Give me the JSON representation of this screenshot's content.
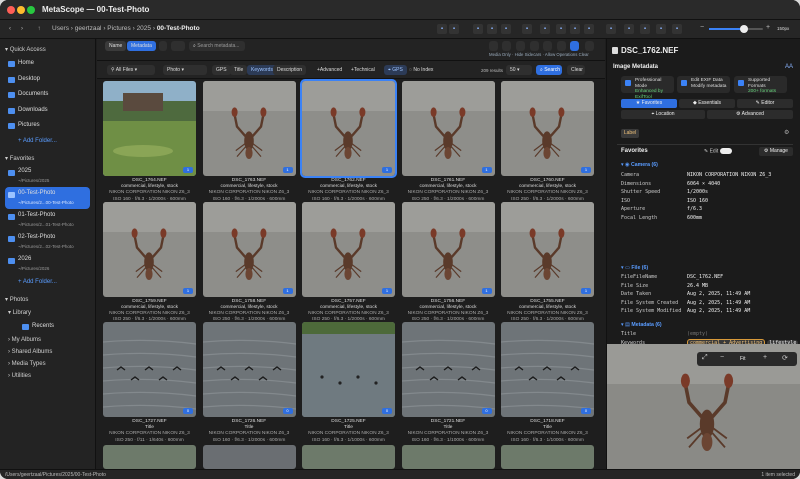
{
  "app": {
    "title": "MetaScope — 00-Test-Photo"
  },
  "breadcrumb": [
    "Users",
    "geertzaal",
    "Pictures",
    "2025",
    "00-Test-Photo"
  ],
  "toolbar": {
    "zoom": 0.65,
    "zoom_label": "150px"
  },
  "sidebar": {
    "quick_access_label": "Quick Access",
    "quick": [
      "Home",
      "Desktop",
      "Documents",
      "Downloads",
      "Pictures"
    ],
    "add_folder": "Add Folder...",
    "favorites_label": "Favorites",
    "favorites": [
      {
        "name": "2025",
        "path": "~/Pictures/2025"
      },
      {
        "name": "00-Test-Photo",
        "path": "~/Pictures/2...00-Test-Photo"
      },
      {
        "name": "01-Test-Photo",
        "path": "~/Pictures/2...01-Test-Photo"
      },
      {
        "name": "02-Test-Photo",
        "path": "~/Pictures/2...02-Test-Photo"
      },
      {
        "name": "2026",
        "path": "~/Pictures/2026"
      }
    ],
    "photos_label": "Photos",
    "library_label": "Library",
    "recents": "Recents",
    "groups": [
      "My Albums",
      "Shared Albums",
      "Media Types",
      "Utilities"
    ]
  },
  "filter": {
    "tabs": [
      "Name",
      "Metadata"
    ],
    "search_placeholder": "Search metadata...",
    "media_only": "Media Only",
    "hide_sidecars": "Hide Sidecars",
    "allow_operations": "Allow Operations",
    "clear": "Clear",
    "all_files": "All Files",
    "photo": "Photo",
    "field_chips": [
      "GPS",
      "Title",
      "Keywords",
      "Description"
    ],
    "advanced": "+Advanced",
    "technical": "+Technical",
    "gps": "GPS",
    "no_index": "No Index",
    "results": "209 results",
    "per_page": "50",
    "search_button": "Search",
    "clear_button": "Clear"
  },
  "photos": [
    {
      "name": "DSC_1764.NEF",
      "line1": "commercial, lifestyle, stock",
      "line2": "NIKON CORPORATION NIKON Z6_3",
      "line3": "ISO 160 · f/6.3 · 1/2000s · 600mm",
      "badge": "1",
      "kind": "field"
    },
    {
      "name": "DSC_1763.NEF",
      "line1": "commercial, lifestyle, stock",
      "line2": "NIKON CORPORATION NIKON Z6_3",
      "line3": "ISO 160 · f/6.3 · 1/2000s · 600mm",
      "badge": "1",
      "kind": "crab"
    },
    {
      "name": "DSC_1762.NEF",
      "line1": "commercial, lifestyle, stock",
      "line2": "NIKON CORPORATION NIKON Z6_3",
      "line3": "ISO 160 · f/6.3 · 1/2000s · 600mm",
      "badge": "1",
      "kind": "crab",
      "selected": true
    },
    {
      "name": "DSC_1761.NEF",
      "line1": "commercial, lifestyle, stock",
      "line2": "NIKON CORPORATION NIKON Z6_3",
      "line3": "ISO 250 · f/6.3 · 1/2000s · 600mm",
      "badge": "1",
      "kind": "crab"
    },
    {
      "name": "DSC_1760.NEF",
      "line1": "commercial, lifestyle, stock",
      "line2": "NIKON CORPORATION NIKON Z6_3",
      "line3": "ISO 250 · f/6.3 · 1/2000s · 600mm",
      "badge": "1",
      "kind": "crab"
    },
    {
      "name": "DSC_1759.NEF",
      "line1": "commercial, lifestyle, stock",
      "line2": "NIKON CORPORATION NIKON Z6_3",
      "line3": "ISO 250 · f/6.3 · 1/2000s · 600mm",
      "badge": "1",
      "kind": "crab"
    },
    {
      "name": "DSC_1758.NEF",
      "line1": "commercial, lifestyle, stock",
      "line2": "NIKON CORPORATION NIKON Z6_3",
      "line3": "ISO 250 · f/6.3 · 1/2000s · 600mm",
      "badge": "1",
      "kind": "crab"
    },
    {
      "name": "DSC_1757.NEF",
      "line1": "commercial, lifestyle, stock",
      "line2": "NIKON CORPORATION NIKON Z6_3",
      "line3": "ISO 250 · f/6.3 · 1/2000s · 600mm",
      "badge": "1",
      "kind": "crab"
    },
    {
      "name": "DSC_1756.NEF",
      "line1": "commercial, lifestyle, stock",
      "line2": "NIKON CORPORATION NIKON Z6_3",
      "line3": "ISO 250 · f/6.3 · 1/2000s · 600mm",
      "badge": "1",
      "kind": "crab"
    },
    {
      "name": "DSC_1755.NEF",
      "line1": "commercial, lifestyle, stock",
      "line2": "NIKON CORPORATION NIKON Z6_3",
      "line3": "ISO 250 · f/6.3 · 1/2000s · 600mm",
      "badge": "1",
      "kind": "crab"
    },
    {
      "name": "DSC_1727.NEF",
      "line1": "Title",
      "line2": "NIKON CORPORATION NIKON Z6_3",
      "line3": "ISO 250 · f/11 · 1/640s · 600mm",
      "badge": "0",
      "kind": "water"
    },
    {
      "name": "DSC_1726.NEF",
      "line1": "Title",
      "line2": "NIKON CORPORATION NIKON Z6_3",
      "line3": "ISO 160 · f/6.3 · 1/2000s · 600mm",
      "badge": "0",
      "kind": "water"
    },
    {
      "name": "DSC_1725.NEF",
      "line1": "Title",
      "line2": "NIKON CORPORATION NIKON Z6_3",
      "line3": "ISO 160 · f/6.3 · 1/1000s · 600mm",
      "badge": "0",
      "kind": "lake"
    },
    {
      "name": "DSC_1721.NEF",
      "line1": "Title",
      "line2": "NIKON CORPORATION NIKON Z6_3",
      "line3": "ISO 160 · f/6.3 · 1/1000s · 600mm",
      "badge": "0",
      "kind": "water"
    },
    {
      "name": "DSC_1718.NEF",
      "line1": "Title",
      "line2": "NIKON CORPORATION NIKON Z6_3",
      "line3": "ISO 160 · f/6.3 · 1/1000s · 600mm",
      "badge": "0",
      "kind": "water"
    }
  ],
  "inspector": {
    "filename": "DSC_1762.NEF",
    "section": "Image Metadata",
    "cards": [
      {
        "title": "Professional Mode",
        "sub": "Enhanced by ExifTool",
        "sub_color": "#66d17a"
      },
      {
        "title": "Edit EXIF Data",
        "sub": "Modify metadata"
      },
      {
        "title": "Supported Formats",
        "sub": "200+ formats",
        "sub_color": "#66d17a"
      }
    ],
    "tabs": [
      "Favorites",
      "Essentials",
      "Editor",
      "Location",
      "Advanced"
    ],
    "label_button": "Label",
    "favorites_label": "Favorites",
    "edit_label": "Edit",
    "manage_label": "Manage",
    "camera_group": "Camera (6)",
    "camera": [
      {
        "k": "Camera",
        "v": "NIKON CORPORATION NIKON Z6_3"
      },
      {
        "k": "Dimensions",
        "v": "6064 × 4040"
      },
      {
        "k": "Shutter Speed",
        "v": "1/2000s"
      },
      {
        "k": "ISO",
        "v": "ISO 160"
      },
      {
        "k": "Aperture",
        "v": "f/6.3"
      },
      {
        "k": "Focal Length",
        "v": "600mm"
      }
    ],
    "file_group": "File (6)",
    "file": [
      {
        "k": "FileFileName",
        "v": "DSC_1762.NEF"
      },
      {
        "k": "File Size",
        "v": "26.4 MB"
      },
      {
        "k": "Date Taken",
        "v": "Aug 2, 2025, 11:49 AM"
      },
      {
        "k": "File System Created",
        "v": "Aug 2, 2025, 11:49 AM"
      },
      {
        "k": "File System Modified",
        "v": "Aug 2, 2025, 11:49 AM"
      }
    ],
    "metadata_group": "Metadata (6)",
    "meta": [
      {
        "k": "Title",
        "v": "(empty)"
      },
      {
        "k": "Keywords",
        "v": ""
      },
      {
        "k": "Description",
        "v": "(empty)"
      },
      {
        "k": "Headline",
        "v": "(empty)"
      },
      {
        "k": "Creator",
        "v": ""
      }
    ],
    "keywords": [
      "commercial + Advertising",
      "lifestyle",
      "stock"
    ],
    "preview_fit": "Fit"
  },
  "status": {
    "path": "/Users/geertzaal/Pictures/2025/00-Test-Photo",
    "right": "1 item selected"
  }
}
